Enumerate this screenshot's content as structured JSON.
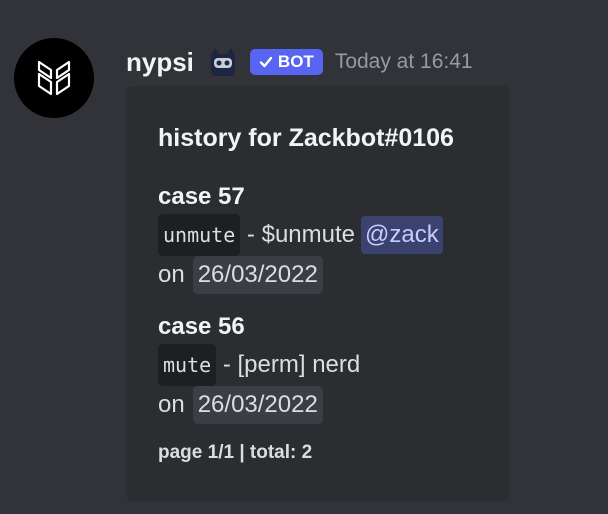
{
  "message": {
    "author": "nypsi",
    "bot_tag": "BOT",
    "timestamp": "Today at 16:41",
    "icons": {
      "avatar": "nypsi-logo-icon",
      "emoji": "bot-face-icon",
      "verified": "checkmark-icon"
    },
    "colors": {
      "bot_tag": "#5865f2",
      "mention": "#c9cdfb",
      "background": "#313338",
      "embed": "#2b2d31"
    }
  },
  "embed": {
    "title": "history for Zackbot#0106",
    "cases": [
      {
        "title": "case 57",
        "type": "unmute",
        "separator": "-",
        "reason": "$unmute",
        "mention": "@zack",
        "on": "on",
        "date": "26/03/2022"
      },
      {
        "title": "case 56",
        "type": "mute",
        "separator": "-",
        "reason": "[perm] nerd",
        "on": "on",
        "date": "26/03/2022"
      }
    ],
    "footer": "page 1/1 | total: 2"
  }
}
